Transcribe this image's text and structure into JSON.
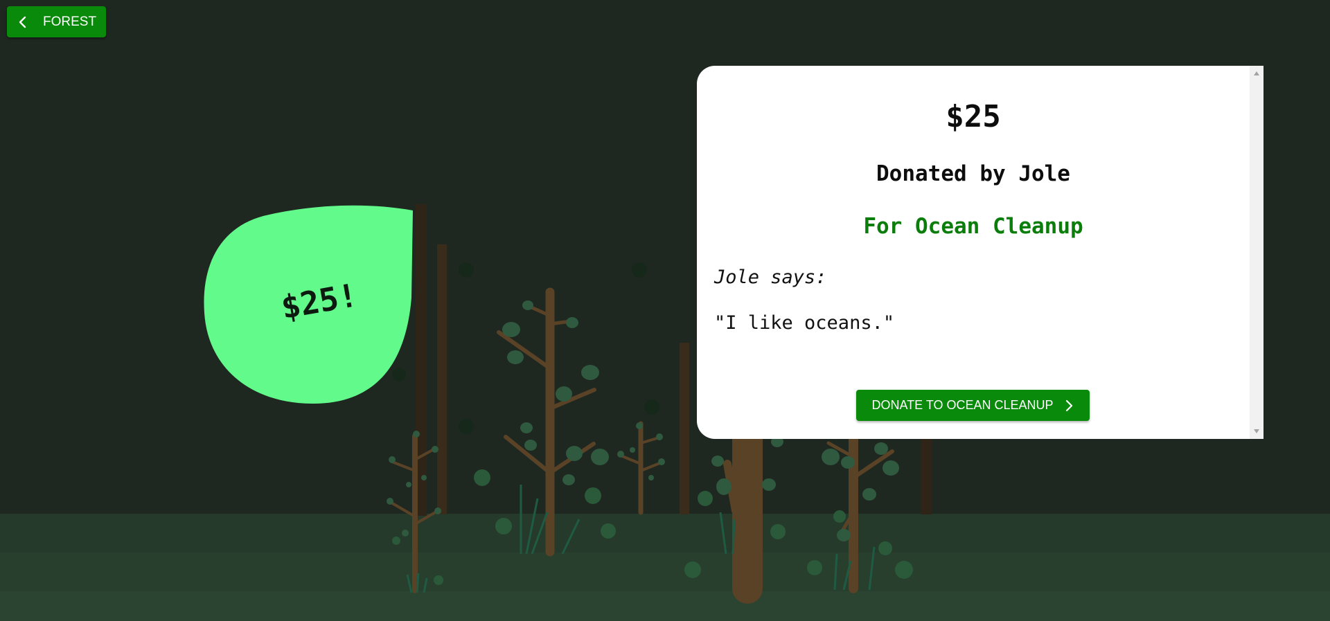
{
  "nav": {
    "back_label": "FOREST",
    "back_icon": "chevron-left-icon"
  },
  "leaf": {
    "label": "$25!",
    "color": "#62fa8a"
  },
  "card": {
    "amount": "$25",
    "donor_line": "Donated by Jole",
    "cause_line": "For Ocean Cleanup",
    "says_line": "Jole says:",
    "message": "\"I like oceans.\"",
    "donate_label": "DONATE TO OCEAN CLEANUP",
    "donate_icon": "chevron-right-icon"
  },
  "colors": {
    "background": "#1f2721",
    "accent": "#0a8a0a",
    "cause_text": "#0b7d0b",
    "ground": "#263a2b"
  }
}
